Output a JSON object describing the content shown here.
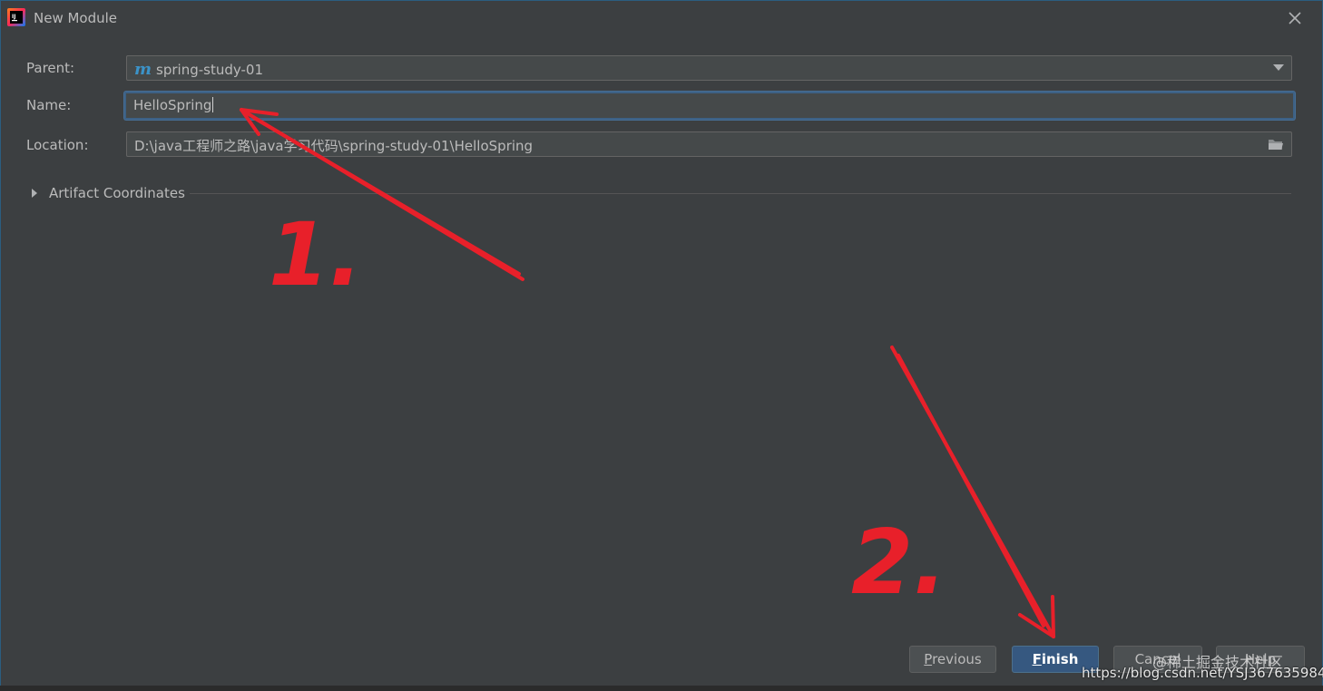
{
  "window": {
    "title": "New Module"
  },
  "form": {
    "parent_label": "Parent:",
    "parent_value": "spring-study-01",
    "parent_icon": "maven-m-icon",
    "name_label": "Name:",
    "name_value": "HelloSpring",
    "location_label": "Location:",
    "location_value": "D:\\java工程师之路\\java学习代码\\spring-study-01\\HelloSpring"
  },
  "section": {
    "artifact_label": "Artifact Coordinates"
  },
  "buttons": {
    "previous_first": "P",
    "previous_rest": "revious",
    "finish_first": "F",
    "finish_rest": "inish",
    "cancel": "Cancel",
    "help": "Help"
  },
  "annotations": {
    "step1": "1.",
    "step2": "2.",
    "color": "#e8202a"
  },
  "watermark": {
    "community": "@稀土掘金技术社区",
    "url": "https://blog.csdn.net/YSJ367635984"
  },
  "colors": {
    "background": "#3c3f41",
    "focus": "#3d6185",
    "primary_button": "#365880"
  }
}
